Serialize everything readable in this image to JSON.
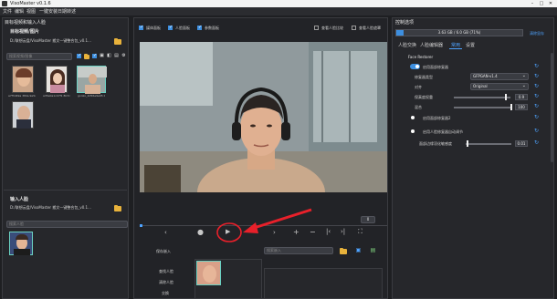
{
  "window": {
    "title": "VisoMaster v0.1.6"
  },
  "menu": [
    "文件",
    "编辑",
    "视图",
    "一键安装日期转述"
  ],
  "left": {
    "target_title": "目标视频和输入人脸",
    "target_subtitle": "目标视频/图片",
    "target_path": "D:/联想云盘/VisoMaster 搬文一键整合包_v0.1...",
    "target_search_placeholder": "搜索视频/图像",
    "thumbs": [
      {
        "caption": "a7f3d49a 384s.9e5c"
      },
      {
        "caption": "a35a0a1c47f1 8b7c8e"
      },
      {
        "caption": "gonko_4d56e9e95 0e_c4"
      },
      {
        "caption": ""
      }
    ],
    "input_title": "输入人脸",
    "input_path": "D:/联想云盘/VisoMaster 搬文一键整合包_v0.1...",
    "input_search_placeholder": "搜索人脸"
  },
  "center": {
    "top_checks": [
      "媒体面板",
      "人脸面板",
      "参数面板"
    ],
    "top_checks_right": [
      "查看人脸比较",
      "查看人脸遮罩"
    ],
    "frame_number": "0",
    "save_embeddings": "保存嵌入",
    "embeddings_placeholder": "搜索嵌入",
    "find_faces": "查找人脸",
    "clear_faces": "清除人脸",
    "swap": "交换"
  },
  "right": {
    "panel_title": "控制选项",
    "vram": "3.63 GB / 6.0 GB (71%)",
    "clear_vram": "清除显存",
    "tabs": [
      "人脸交换",
      "人脸编辑器",
      "常用",
      "设置"
    ],
    "section": "Face Restorer",
    "enable_restorer": "启用面部修复器",
    "restorer_type_label": "修复器类型",
    "restorer_type_value": "GFPGAN-v1.4",
    "align_label": "对齐",
    "align_value": "Original",
    "fidelity_label": "保真度权重",
    "fidelity_value": "0.9",
    "fidelity_fraction": 0.9,
    "blend_label": "混合",
    "blend_value": "100",
    "blend_fraction": 1.0,
    "enable_restorer2": "启用面部修复器2",
    "enable_auto": "启用人脸修复器自动调节",
    "auto_label": "面部边缘羽化敏感度",
    "auto_value": "0.01",
    "auto_fraction": 0.05
  },
  "colors": {
    "accent": "#3d8fe0",
    "annotation_red": "#e8202a"
  }
}
